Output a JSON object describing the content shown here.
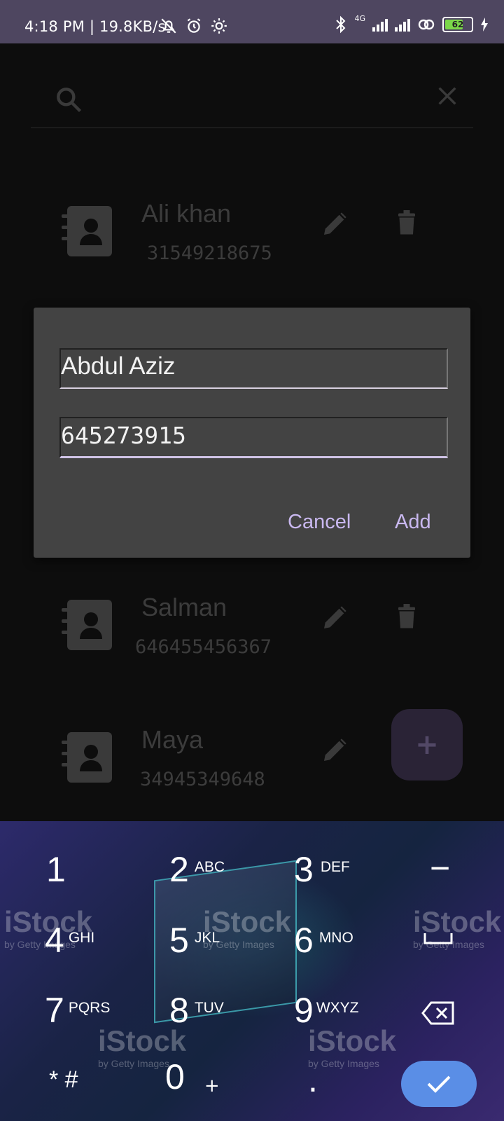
{
  "status_bar": {
    "time_speed": "4:18 PM | 19.8KB/s",
    "network": "4G",
    "battery": "62"
  },
  "search": {
    "placeholder": ""
  },
  "contacts": [
    {
      "name": "Ali khan",
      "phone": "31549218675"
    },
    {
      "name": "Salman",
      "phone": "646455456367"
    },
    {
      "name": "Maya",
      "phone": "34945349648"
    }
  ],
  "dialog": {
    "name_value": "Abdul Aziz",
    "phone_value": "645273915",
    "cancel_label": "Cancel",
    "add_label": "Add"
  },
  "fab": {
    "label": "+"
  },
  "keyboard": {
    "keys": [
      {
        "num": "1",
        "letters": ""
      },
      {
        "num": "2",
        "letters": "ABC"
      },
      {
        "num": "3",
        "letters": "DEF"
      },
      {
        "num": "4",
        "letters": "GHI"
      },
      {
        "num": "5",
        "letters": "JKL"
      },
      {
        "num": "6",
        "letters": "MNO"
      },
      {
        "num": "7",
        "letters": "PQRS"
      },
      {
        "num": "8",
        "letters": "TUV"
      },
      {
        "num": "9",
        "letters": "WXYZ"
      },
      {
        "num": "* #",
        "letters": ""
      },
      {
        "num": "0",
        "letters": "+"
      },
      {
        "num": ".",
        "letters": ""
      }
    ],
    "minus": "−",
    "watermark": "iStock",
    "watermark_sub": "by Getty Images"
  },
  "colors": {
    "accent": "#c9b8ef",
    "dialog_bg": "#434343",
    "fab": "#2a2336",
    "done": "#5a8ee6"
  }
}
